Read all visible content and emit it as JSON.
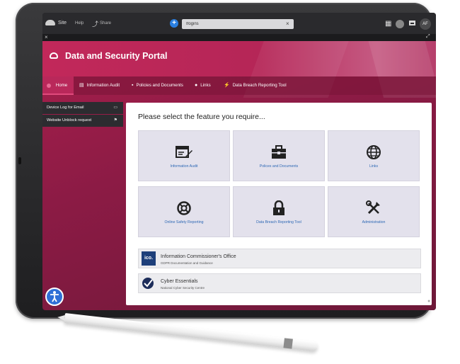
{
  "toolbar": {
    "site_label": "Site",
    "help_label": "Help",
    "share_label": "Share",
    "search_value": "Ifogins",
    "clear_symbol": "×",
    "avatar_initials": "AF"
  },
  "closebar": {
    "close_symbol": "×",
    "expand_symbol": "⤢"
  },
  "portal": {
    "title": "Data and Security Portal"
  },
  "nav": {
    "items": [
      {
        "label": "Home",
        "icon": "home-dot"
      },
      {
        "label": "Information Audit",
        "icon": "document-icon"
      },
      {
        "label": "Policies and Documents",
        "icon": "folder-icon"
      },
      {
        "label": "Links",
        "icon": "link-icon"
      },
      {
        "label": "Data Breach Reporting Tool",
        "icon": "bolt-icon"
      }
    ]
  },
  "sidebar": {
    "items": [
      {
        "label": "Device Log for Email",
        "icon": "monitor-icon"
      },
      {
        "label": "Website Unblock request",
        "icon": "flag-icon"
      }
    ]
  },
  "main": {
    "heading": "Please select the feature you require...",
    "features": [
      {
        "label": "Information Audit",
        "icon": "audit-edit-icon"
      },
      {
        "label": "Polices and Documents",
        "icon": "briefcase-icon"
      },
      {
        "label": "Links",
        "icon": "globe-icon"
      },
      {
        "label": "Online Safety Reporting",
        "icon": "lifebuoy-icon"
      },
      {
        "label": "Data Breach Reporting Tool",
        "icon": "lock-icon"
      },
      {
        "label": "Administration",
        "icon": "tools-icon"
      }
    ],
    "links": [
      {
        "title": "Information Commissioner's Office",
        "subtitle": "GDPR Documentation and Guidance",
        "logo_text": "ico."
      },
      {
        "title": "Cyber Essentials",
        "subtitle": "National Cyber Security Centre",
        "logo": "cyber-essentials-logo"
      }
    ]
  },
  "colors": {
    "brand_primary": "#b9285a",
    "brand_dark": "#7a1a3f",
    "link_blue": "#2f69b5",
    "tile_bg": "#e3e1ec"
  }
}
